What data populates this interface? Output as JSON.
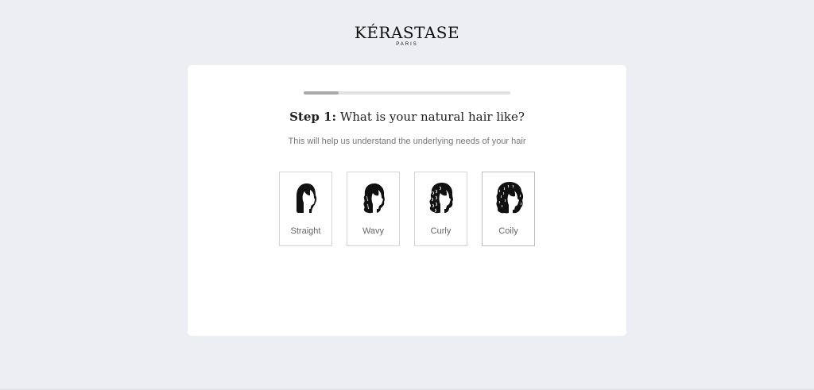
{
  "brand": {
    "name": "KÉRASTASE",
    "city": "PARIS"
  },
  "progress": {
    "value": 0.17
  },
  "question": {
    "step_label": "Step 1:",
    "text": " What is your natural hair like?",
    "subtitle": "This will help us understand the underlying needs of your hair"
  },
  "options": [
    {
      "label": "Straight",
      "icon": "straight-hair-icon"
    },
    {
      "label": "Wavy",
      "icon": "wavy-hair-icon"
    },
    {
      "label": "Curly",
      "icon": "curly-hair-icon"
    },
    {
      "label": "Coily",
      "icon": "coily-hair-icon"
    }
  ]
}
